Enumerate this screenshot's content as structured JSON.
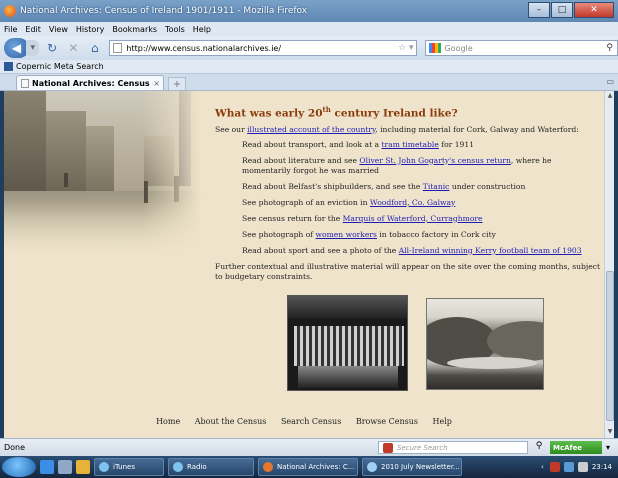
{
  "window": {
    "title": "National Archives: Census of Ireland 1901/1911 - Mozilla Firefox"
  },
  "menu": [
    "File",
    "Edit",
    "View",
    "History",
    "Bookmarks",
    "Tools",
    "Help"
  ],
  "nav": {
    "url": "http://www.census.nationalarchives.ie/",
    "search_placeholder": "Google"
  },
  "bookmarks": {
    "item": "Copernic Meta Search"
  },
  "tabs": {
    "active": "National Archives: Census of Ireland ..."
  },
  "page": {
    "heading_prefix": "What was early 20",
    "heading_sup": "th",
    "heading_suffix": " century Ireland like?",
    "intro_prefix": "See our ",
    "intro_link": "illustrated account of the country",
    "intro_suffix": ", including material for Cork, Galway and Waterford:",
    "items": [
      {
        "pre": "Read about transport, and look at a ",
        "link": "tram timetable",
        "post": " for 1911"
      },
      {
        "pre": "Read about literature and see ",
        "link": "Oliver St. John Gogarty's census return",
        "post": ", where he momentarily forgot he was married"
      },
      {
        "pre": "Read about Belfast's shipbuilders, and see the ",
        "link": "Titanic",
        "post": " under construction"
      },
      {
        "pre": "See photograph of an eviction in ",
        "link": "Woodford, Co. Galway",
        "post": ""
      },
      {
        "pre": "See census return for the ",
        "link": "Marquis of Waterford, Curraghmore",
        "post": ""
      },
      {
        "pre": "See photograph of ",
        "link": "women workers",
        "post": " in tobacco factory in Cork city"
      },
      {
        "pre": "Read about sport and see a photo of the ",
        "link": "All-Ireland winning Kerry football team of 1903",
        "post": ""
      }
    ],
    "closing": "Further contextual and illustrative material will appear on the site over the coming months, subject to budgetary constraints."
  },
  "footer_nav": [
    "Home",
    "About the Census",
    "Search Census",
    "Browse Census",
    "Help"
  ],
  "status": {
    "text": "Done",
    "secure_search": "Secure Search",
    "mcafee": "McAfee"
  },
  "taskbar": {
    "items": [
      "iTunes",
      "Radio",
      "National Archives: C...",
      "2010 July Newsletter..."
    ],
    "clock": "23:14"
  },
  "colors": {
    "page_bg": "#efe4cb",
    "heading": "#8a3b0c",
    "link": "#1d1db5"
  }
}
